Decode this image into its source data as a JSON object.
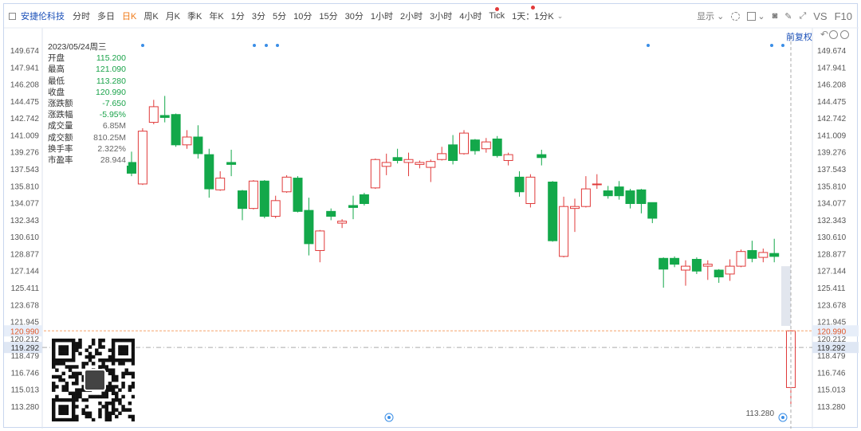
{
  "toolbar": {
    "stock_name": "安捷伦科技",
    "periods": [
      "分时",
      "多日",
      "日K",
      "周K",
      "月K",
      "季K",
      "年K",
      "1分",
      "3分",
      "5分",
      "10分",
      "15分",
      "30分",
      "1小时",
      "2小时",
      "3小时",
      "4小时",
      "Tick",
      "1天：1分K"
    ],
    "active_period": "日K",
    "display_label": "显示",
    "vs_label": "VS",
    "f10_label": "F10",
    "adjust_label": "前复权"
  },
  "info": {
    "date": "2023/05/24周三",
    "rows": [
      {
        "label": "开盘",
        "value": "115.200",
        "color": "green"
      },
      {
        "label": "最高",
        "value": "121.090",
        "color": "green"
      },
      {
        "label": "最低",
        "value": "113.280",
        "color": "green"
      },
      {
        "label": "收盘",
        "value": "120.990",
        "color": "green"
      },
      {
        "label": "涨跌额",
        "value": "-7.650",
        "color": "green"
      },
      {
        "label": "涨跌幅",
        "value": "-5.95%",
        "color": "green"
      },
      {
        "label": "成交量",
        "value": "6.85M",
        "color": "gray"
      },
      {
        "label": "成交额",
        "value": "810.25M",
        "color": "gray"
      },
      {
        "label": "换手率",
        "value": "2.322%",
        "color": "gray"
      },
      {
        "label": "市盈率",
        "value": "28.944",
        "color": "gray"
      }
    ]
  },
  "chart_data": {
    "type": "candlestick",
    "y_ticks": [
      "149.674",
      "147.941",
      "146.208",
      "144.475",
      "142.742",
      "141.009",
      "139.276",
      "137.543",
      "135.810",
      "134.077",
      "132.343",
      "130.610",
      "128.877",
      "127.144",
      "125.411",
      "123.678",
      "121.945",
      "120.212",
      "118.479",
      "116.746",
      "115.013",
      "113.280"
    ],
    "ylim": [
      113.28,
      149.674
    ],
    "current_price": "120.990",
    "cursor_price": "119.292",
    "low_label": "113.280",
    "candles": [
      {
        "o": 138.2,
        "c": 137.1,
        "h": 139.3,
        "l": 136.8
      },
      {
        "o": 136.0,
        "c": 141.4,
        "h": 141.7,
        "l": 135.9
      },
      {
        "o": 142.3,
        "c": 143.9,
        "h": 144.6,
        "l": 142.1
      },
      {
        "o": 143.0,
        "c": 142.8,
        "h": 145.0,
        "l": 142.3
      },
      {
        "o": 143.1,
        "c": 140.0,
        "h": 143.2,
        "l": 139.8
      },
      {
        "o": 140.0,
        "c": 140.8,
        "h": 141.5,
        "l": 139.6
      },
      {
        "o": 140.8,
        "c": 139.1,
        "h": 142.0,
        "l": 138.6
      },
      {
        "o": 139.0,
        "c": 135.5,
        "h": 139.6,
        "l": 134.6
      },
      {
        "o": 135.4,
        "c": 136.6,
        "h": 137.3,
        "l": 135.3
      },
      {
        "o": 138.2,
        "c": 138.0,
        "h": 139.5,
        "l": 136.8
      },
      {
        "o": 135.3,
        "c": 133.5,
        "h": 135.4,
        "l": 132.3
      },
      {
        "o": 133.5,
        "c": 136.3,
        "h": 136.4,
        "l": 133.4
      },
      {
        "o": 136.3,
        "c": 132.7,
        "h": 136.4,
        "l": 132.5
      },
      {
        "o": 132.7,
        "c": 134.3,
        "h": 134.8,
        "l": 132.5
      },
      {
        "o": 135.2,
        "c": 136.7,
        "h": 136.9,
        "l": 135.1
      },
      {
        "o": 136.6,
        "c": 133.2,
        "h": 136.8,
        "l": 133.1
      },
      {
        "o": 133.3,
        "c": 129.9,
        "h": 134.6,
        "l": 128.7
      },
      {
        "o": 129.2,
        "c": 131.2,
        "h": 131.3,
        "l": 128.0
      },
      {
        "o": 133.2,
        "c": 132.7,
        "h": 133.5,
        "l": 132.3
      },
      {
        "o": 132.0,
        "c": 132.2,
        "h": 132.4,
        "l": 131.5
      },
      {
        "o": 133.8,
        "c": 133.6,
        "h": 134.8,
        "l": 132.4
      },
      {
        "o": 134.9,
        "c": 134.0,
        "h": 135.1,
        "l": 133.8
      },
      {
        "o": 135.6,
        "c": 138.5,
        "h": 138.6,
        "l": 135.5
      },
      {
        "o": 137.8,
        "c": 138.2,
        "h": 139.1,
        "l": 136.9
      },
      {
        "o": 138.7,
        "c": 138.4,
        "h": 139.6,
        "l": 138.1
      },
      {
        "o": 138.2,
        "c": 138.5,
        "h": 139.2,
        "l": 136.8
      },
      {
        "o": 138.0,
        "c": 138.2,
        "h": 138.4,
        "l": 137.6
      },
      {
        "o": 137.7,
        "c": 138.3,
        "h": 138.5,
        "l": 136.2
      },
      {
        "o": 138.5,
        "c": 139.1,
        "h": 139.8,
        "l": 138.4
      },
      {
        "o": 140.0,
        "c": 138.4,
        "h": 141.0,
        "l": 138.0
      },
      {
        "o": 139.1,
        "c": 141.2,
        "h": 141.5,
        "l": 139.0
      },
      {
        "o": 140.5,
        "c": 139.4,
        "h": 140.6,
        "l": 139.0
      },
      {
        "o": 139.6,
        "c": 140.3,
        "h": 140.7,
        "l": 139.2
      },
      {
        "o": 140.6,
        "c": 138.9,
        "h": 140.9,
        "l": 138.7
      },
      {
        "o": 138.4,
        "c": 139.0,
        "h": 139.2,
        "l": 137.9
      },
      {
        "o": 136.7,
        "c": 135.2,
        "h": 137.3,
        "l": 134.7
      },
      {
        "o": 134.0,
        "c": 136.7,
        "h": 137.0,
        "l": 133.6
      },
      {
        "o": 139.0,
        "c": 138.7,
        "h": 139.5,
        "l": 137.9
      },
      {
        "o": 136.2,
        "c": 130.2,
        "h": 136.3,
        "l": 130.1
      },
      {
        "o": 128.6,
        "c": 133.7,
        "h": 134.7,
        "l": 128.5
      },
      {
        "o": 133.5,
        "c": 133.7,
        "h": 134.5,
        "l": 131.1
      },
      {
        "o": 133.7,
        "c": 135.5,
        "h": 136.8,
        "l": 133.6
      },
      {
        "o": 136.0,
        "c": 136.0,
        "h": 137.0,
        "l": 135.5
      },
      {
        "o": 135.3,
        "c": 134.8,
        "h": 135.8,
        "l": 134.5
      },
      {
        "o": 135.7,
        "c": 134.8,
        "h": 136.3,
        "l": 134.4
      },
      {
        "o": 135.3,
        "c": 134.0,
        "h": 135.5,
        "l": 133.5
      },
      {
        "o": 135.4,
        "c": 134.0,
        "h": 135.5,
        "l": 133.0
      },
      {
        "o": 134.1,
        "c": 132.5,
        "h": 134.1,
        "l": 132.0
      },
      {
        "o": 128.4,
        "c": 127.3,
        "h": 128.5,
        "l": 125.4
      },
      {
        "o": 128.4,
        "c": 127.8,
        "h": 128.6,
        "l": 127.5
      },
      {
        "o": 127.2,
        "c": 127.6,
        "h": 128.2,
        "l": 125.6
      },
      {
        "o": 128.3,
        "c": 127.1,
        "h": 128.5,
        "l": 126.8
      },
      {
        "o": 127.6,
        "c": 127.8,
        "h": 128.2,
        "l": 126.2
      },
      {
        "o": 127.2,
        "c": 126.5,
        "h": 127.3,
        "l": 125.9
      },
      {
        "o": 126.8,
        "c": 127.6,
        "h": 128.3,
        "l": 126.1
      },
      {
        "o": 127.6,
        "c": 129.1,
        "h": 129.3,
        "l": 127.5
      },
      {
        "o": 129.2,
        "c": 128.4,
        "h": 130.2,
        "l": 128.0
      },
      {
        "o": 128.5,
        "c": 129.0,
        "h": 129.4,
        "l": 128.0
      },
      {
        "o": 128.9,
        "c": 128.6,
        "h": 130.4,
        "l": 128.0
      },
      {
        "o": 115.2,
        "c": 120.99,
        "h": 121.09,
        "l": 113.28
      }
    ]
  },
  "colors": {
    "up": "#e03a3a",
    "down": "#13a84a",
    "accent": "#1a4fb8",
    "active": "#f07a18"
  }
}
